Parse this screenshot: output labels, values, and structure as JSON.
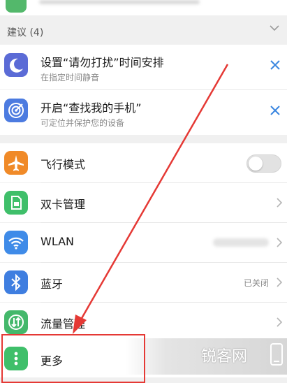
{
  "suggestions": {
    "header": "建议 (4)",
    "items": [
      {
        "title": "设置“请勿打扰”时间安排",
        "subtitle": "在指定时间静音",
        "icon": "moon-icon",
        "color": "#5b6bd6"
      },
      {
        "title": "开启“查找我的手机”",
        "subtitle": "可定位并保护您的设备",
        "icon": "target-icon",
        "color": "#4c7be0"
      }
    ]
  },
  "settings": {
    "items": [
      {
        "label": "飞行模式",
        "icon": "airplane-icon",
        "color": "#f08a28",
        "control": "toggle",
        "toggle_on": false
      },
      {
        "label": "双卡管理",
        "icon": "sim-card-icon",
        "color": "#3fbf6a",
        "control": "chevron"
      },
      {
        "label": "WLAN",
        "icon": "wifi-icon",
        "color": "#3f8be8",
        "control": "chevron"
      },
      {
        "label": "蓝牙",
        "icon": "bluetooth-icon",
        "color": "#3f7ee0",
        "control": "chevron",
        "value": "已关闭"
      },
      {
        "label": "流量管理",
        "icon": "data-usage-icon",
        "color": "#44b86b",
        "control": "chevron"
      },
      {
        "label": "更多",
        "icon": "more-dots-icon",
        "color": "#3fbf6a",
        "control": "chevron"
      }
    ]
  },
  "annotation": {
    "highlight_color": "#e53935"
  },
  "watermark": {
    "text": "锐客网"
  }
}
